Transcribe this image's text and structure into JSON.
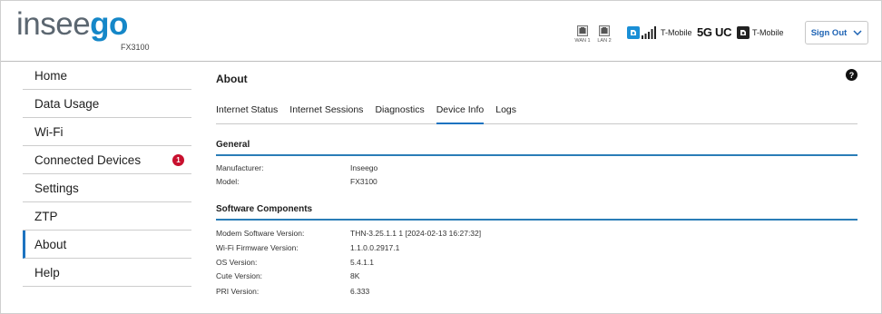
{
  "header": {
    "logo_part1": "insee",
    "logo_part2": "go",
    "device_model": "FX3100",
    "ports": [
      {
        "label": "WAN 1",
        "icon": "ethernet-port-icon"
      },
      {
        "label": "LAN 2",
        "icon": "ethernet-port-icon"
      }
    ],
    "carrier_primary": "T-Mobile",
    "network_type": "5G UC",
    "carrier_secondary": "T-Mobile",
    "signout_label": "Sign Out",
    "accent_color": "#1587c8"
  },
  "sidebar": {
    "items": [
      {
        "label": "Home"
      },
      {
        "label": "Data Usage"
      },
      {
        "label": "Wi-Fi"
      },
      {
        "label": "Connected Devices",
        "badge": "1"
      },
      {
        "label": "Settings"
      },
      {
        "label": "ZTP"
      },
      {
        "label": "About",
        "active": true
      },
      {
        "label": "Help"
      }
    ]
  },
  "main": {
    "title": "About",
    "help_icon": "?",
    "tabs": [
      {
        "label": "Internet Status"
      },
      {
        "label": "Internet Sessions"
      },
      {
        "label": "Diagnostics"
      },
      {
        "label": "Device Info",
        "active": true
      },
      {
        "label": "Logs"
      }
    ],
    "general": {
      "title": "General",
      "rows": [
        {
          "key": "Manufacturer:",
          "value": "Inseego"
        },
        {
          "key": "Model:",
          "value": "FX3100"
        }
      ]
    },
    "software": {
      "title": "Software Components",
      "rows": [
        {
          "key": "Modem Software Version:",
          "value": "THN-3.25.1.1 1 [2024-02-13 16:27:32]"
        },
        {
          "key": "Wi-Fi Firmware Version:",
          "value": "1.1.0.0.2917.1"
        },
        {
          "key": "OS Version:",
          "value": "5.4.1.1"
        },
        {
          "key": "Cute Version:",
          "value": "8K"
        },
        {
          "key": "PRI Version:",
          "value": "6.333"
        }
      ]
    }
  }
}
